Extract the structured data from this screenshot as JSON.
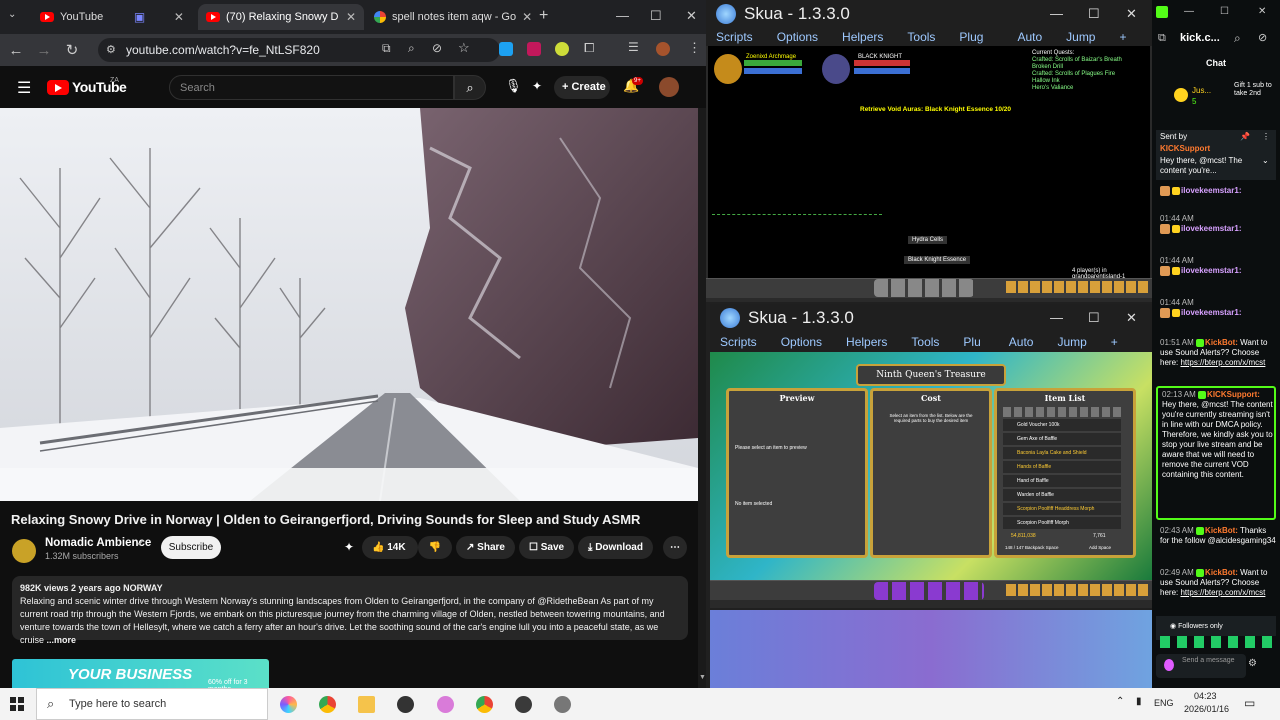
{
  "chrome": {
    "tabs": [
      {
        "title": "YouTube"
      },
      {
        "title": "(70) Relaxing Snowy D"
      },
      {
        "title": "spell notes item aqw - Go"
      }
    ],
    "url": "youtube.com/watch?v=fe_NtLSF820"
  },
  "youtube": {
    "logo_text": "YouTube",
    "region": "ZA",
    "search_placeholder": "Search",
    "create_label": "Create",
    "notif_count": "9+",
    "video_title": "Relaxing Snowy Drive in Norway | Olden to Geirangerfjord, Driving Sounds for Sleep and Study ASMR",
    "channel_name": "Nomadic Ambience",
    "subscribers": "1.32M subscribers",
    "subscribe_label": "Subscribe",
    "likes": "14K",
    "share_label": "Share",
    "save_label": "Save",
    "download_label": "Download",
    "views_meta": "982K views  2 years ago  NORWAY",
    "description": "Relaxing and scenic winter drive through Western Norway's stunning landscapes from Olden to Geirangerfjord, in the company of @RidetheBean  As part of my current road trip through the Western Fjords, we embark on this picturesque journey from the charming village of Olden, nestled between towering mountains, and venture towards the town of Hellesylt, where we catch a ferry after an hour's drive. Let the soothing sound of the car's engine lull you into a peaceful state, as we cruise",
    "more_label": "...more",
    "ad_text": "YOUR BUSINESS",
    "ad_sub": "60% off for 3 months"
  },
  "skua1": {
    "title": "Skua - 1.3.3.0",
    "menu": [
      "Scripts",
      "Options",
      "Helpers",
      "Tools",
      "Plug",
      "Auto",
      "Jump",
      "+"
    ],
    "player1": "Zoenixd Archmage",
    "enemy": "BLACK KNIGHT",
    "quests_title": "Current Quests:",
    "quests": [
      "Crafted: Scrolls of Baizar's Breath",
      "Broken Drill",
      "Crafted: Scrolls of Plagues Fire",
      "Hallow Ink",
      "Hero's Valiance"
    ],
    "quest_message": "Retrieve Void Auras: Black Knight Essence 10/20",
    "drops": [
      "Hydra Cells",
      "Black Knight Essence"
    ],
    "players": "4 player(s) in grandparentisland-1"
  },
  "skua2": {
    "title": "Skua - 1.3.3.0",
    "menu": [
      "Scripts",
      "Options",
      "Helpers",
      "Tools",
      "Plu",
      "Auto",
      "Jump",
      "+"
    ],
    "shop_title": "Ninth Queen's Treasure",
    "preview_label": "Preview",
    "cost_label": "Cost",
    "itemlist_label": "Item List",
    "preview_msg": "Please select an item to preview",
    "cost_msg": "Select an item from the list. Below are the required parts to buy the desired item",
    "no_item": "No item selected",
    "items": [
      "Gold Voucher 100k",
      "Gem Axe of Baffle",
      "Baconia Layla Cake and Shield",
      "Hands of Baffle",
      "Hand of Baffle",
      "Warden of Baffle",
      "Scorpion Poolfiff Headdress Morph",
      "Scorpion Poolfiff Morph"
    ],
    "gold": "54,811,038",
    "coins": "7,761",
    "backpack": "148 / 147  Backpack Space",
    "add_space": "Add Space"
  },
  "kick": {
    "channel": "kick.c...",
    "chat_label": "Chat",
    "gift_user": "Jus...",
    "gift_count": "5",
    "gift_text": "Gift 1 sub to take 2nd",
    "pinned_by": "Sent by",
    "pinned_user": "KICKSupport",
    "pinned_text": "Hey there, @mcst! The content you're...",
    "messages": [
      {
        "time": "",
        "user": "ilovekeemstar1:",
        "text": ""
      },
      {
        "time": "01:44 AM",
        "user": "ilovekeemstar1:",
        "text": ""
      },
      {
        "time": "01:44 AM",
        "user": "ilovekeemstar1:",
        "text": ""
      },
      {
        "time": "01:44 AM",
        "user": "ilovekeemstar1:",
        "text": ""
      },
      {
        "time": "01:51 AM",
        "user": "KickBot:",
        "text": "Want to use Sound Alerts?? Choose here:",
        "link": "https://bterp.com/x/mcst"
      },
      {
        "time": "02:13 AM",
        "user": "KICKSupport:",
        "text": "Hey there, @mcst! The content you're currently streaming isn't in line with our DMCA policy. Therefore, we kindly ask you to stop your live stream and be aware that we will need to remove the current VOD containing this content."
      },
      {
        "time": "02:43 AM",
        "user": "KickBot:",
        "text": "Thanks for the follow @alcidesgaming34"
      },
      {
        "time": "02:49 AM",
        "user": "KickBot:",
        "text": "Want to use Sound Alerts?? Choose here:",
        "link": "https://bterp.com/x/mcst"
      }
    ],
    "followers_only": "Followers only",
    "send_placeholder": "Send a message"
  },
  "taskbar": {
    "search_placeholder": "Type here to search",
    "lang": "ENG",
    "time": "04:23",
    "date": "2026/01/16"
  }
}
